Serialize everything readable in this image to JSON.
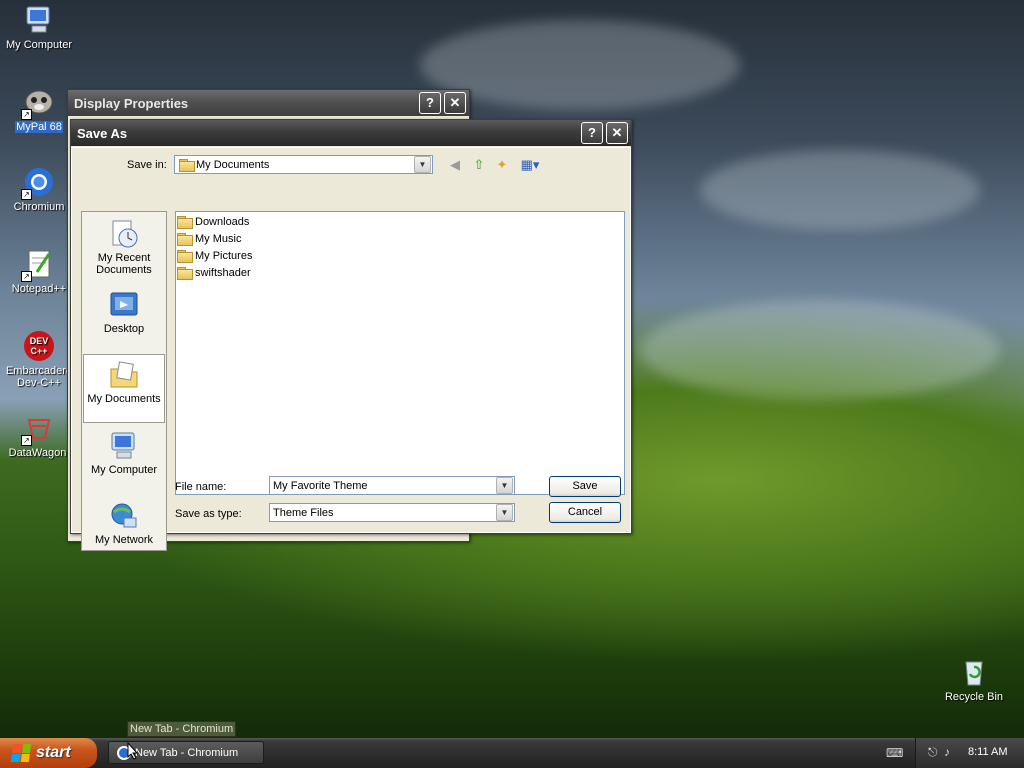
{
  "desktop": {
    "icons": [
      {
        "label": "My Computer"
      },
      {
        "label": "MyPal 68"
      },
      {
        "label": "Chromium"
      },
      {
        "label": "Notepad++"
      },
      {
        "label": "Embarcadero Dev-C++"
      },
      {
        "label": "DataWagon."
      },
      {
        "label": "Recycle Bin"
      }
    ]
  },
  "display_properties": {
    "title": "Display Properties",
    "help_label": "?",
    "close_label": "✕"
  },
  "save_as": {
    "title": "Save As",
    "help_label": "?",
    "close_label": "✕",
    "save_in_label": "Save in:",
    "save_in_value": "My Documents",
    "places": [
      {
        "label": "My Recent Documents"
      },
      {
        "label": "Desktop"
      },
      {
        "label": "My Documents"
      },
      {
        "label": "My Computer"
      },
      {
        "label": "My Network"
      }
    ],
    "files": [
      {
        "name": "Downloads"
      },
      {
        "name": "My Music"
      },
      {
        "name": "My Pictures"
      },
      {
        "name": "swiftshader"
      }
    ],
    "file_name_label": "File name:",
    "file_name_value": "My Favorite Theme",
    "save_type_label": "Save as type:",
    "save_type_value": "Theme Files",
    "save_button": "Save",
    "cancel_button": "Cancel"
  },
  "taskbar": {
    "start_label": "start",
    "task_label": "New Tab - Chromium",
    "tooltip": "New Tab - Chromium",
    "clock": "8:11 AM"
  },
  "colors": {
    "selection": "#316ac5",
    "start_button": "#c8551c",
    "dialog_bg": "#ece9d8"
  }
}
